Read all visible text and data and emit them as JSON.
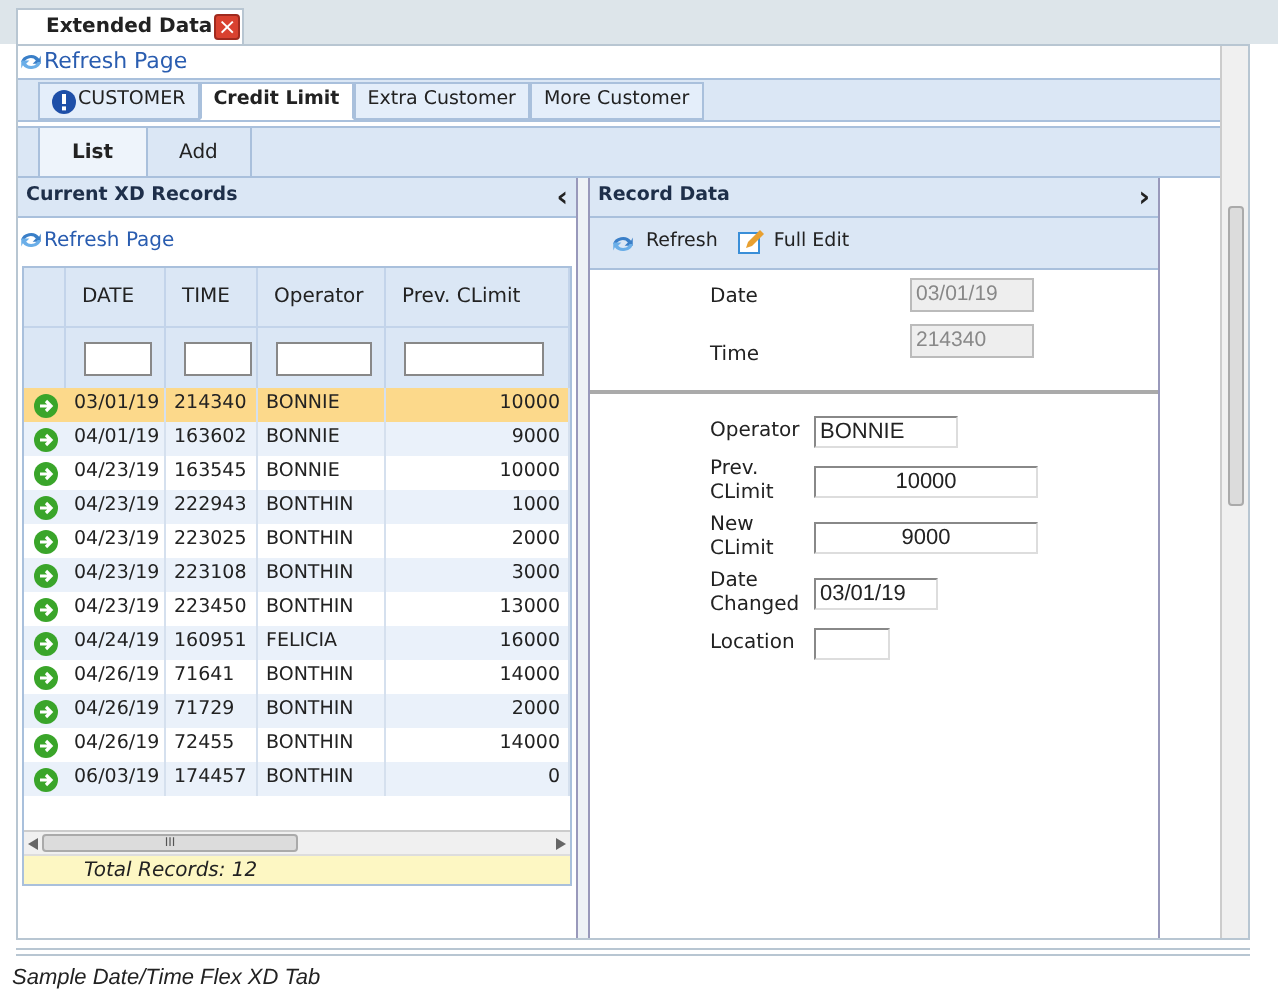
{
  "window_tab": {
    "title": "Extended Data",
    "close": "×"
  },
  "refresh_link": "Refresh Page",
  "tabs": [
    {
      "label": "CUSTOMER",
      "selected": false,
      "alert": true
    },
    {
      "label": "Credit Limit",
      "selected": true,
      "alert": false
    },
    {
      "label": "Extra Customer",
      "selected": false,
      "alert": false
    },
    {
      "label": "More Customer",
      "selected": false,
      "alert": false
    }
  ],
  "subtabs": [
    {
      "label": "List",
      "selected": true
    },
    {
      "label": "Add",
      "selected": false
    }
  ],
  "left_panel": {
    "title": "Current XD Records",
    "collapse": "‹",
    "refresh_link": "Refresh Page",
    "table": {
      "columns": [
        "DATE",
        "TIME",
        "Operator",
        "Prev. CLimit"
      ],
      "rows": [
        {
          "cells": [
            "03/01/19",
            "214340",
            "BONNIE",
            "10000"
          ],
          "selected": true
        },
        {
          "cells": [
            "04/01/19",
            "163602",
            "BONNIE",
            "9000"
          ],
          "selected": false
        },
        {
          "cells": [
            "04/23/19",
            "163545",
            "BONNIE",
            "10000"
          ],
          "selected": false
        },
        {
          "cells": [
            "04/23/19",
            "222943",
            "BONTHIN",
            "1000"
          ],
          "selected": false
        },
        {
          "cells": [
            "04/23/19",
            "223025",
            "BONTHIN",
            "2000"
          ],
          "selected": false
        },
        {
          "cells": [
            "04/23/19",
            "223108",
            "BONTHIN",
            "3000"
          ],
          "selected": false
        },
        {
          "cells": [
            "04/23/19",
            "223450",
            "BONTHIN",
            "13000"
          ],
          "selected": false
        },
        {
          "cells": [
            "04/24/19",
            "160951",
            "FELICIA",
            "16000"
          ],
          "selected": false
        },
        {
          "cells": [
            "04/26/19",
            "71641",
            "BONTHIN",
            "14000"
          ],
          "selected": false
        },
        {
          "cells": [
            "04/26/19",
            "71729",
            "BONTHIN",
            "2000"
          ],
          "selected": false
        },
        {
          "cells": [
            "04/26/19",
            "72455",
            "BONTHIN",
            "14000"
          ],
          "selected": false
        },
        {
          "cells": [
            "06/03/19",
            "174457",
            "BONTHIN",
            "0"
          ],
          "selected": false
        }
      ],
      "scroll_grip": "III",
      "footer": "Total Records: 12"
    }
  },
  "right_panel": {
    "title": "Record Data",
    "expand": "›",
    "toolbar": [
      "Refresh",
      "Full Edit"
    ],
    "top_fields": [
      {
        "label": "Date",
        "value": "03/01/19",
        "disabled": true
      },
      {
        "label": "Time",
        "value": "214340",
        "disabled": true
      }
    ],
    "fields": [
      {
        "label": "Operator",
        "value": "BONNIE"
      },
      {
        "label": "Prev. CLimit",
        "value": "10000"
      },
      {
        "label": "New CLimit",
        "value": "9000"
      },
      {
        "label": "Date Changed",
        "value": "03/01/19"
      },
      {
        "label": "Location"
      }
    ]
  },
  "caption": "Sample Date/Time Flex XD Tab"
}
